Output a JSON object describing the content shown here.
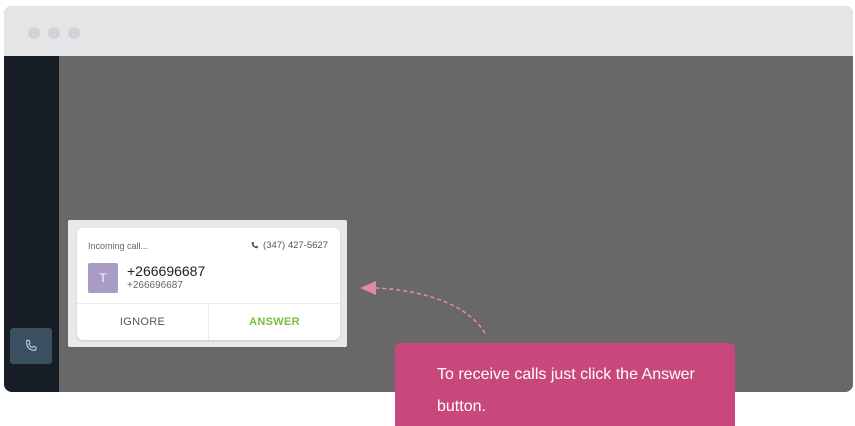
{
  "window": {
    "controls": [
      "close",
      "minimize",
      "maximize"
    ]
  },
  "sidebar": {
    "phone_button_icon": "phone-icon"
  },
  "call_card": {
    "status": "Incoming call...",
    "line_number": "(347) 427-5627",
    "avatar_letter": "T",
    "caller_name": "+266696687",
    "caller_number": "+266696687",
    "ignore_label": "IGNORE",
    "answer_label": "ANSWER"
  },
  "tooltip": {
    "text": "To receive calls just click the Answer button."
  },
  "colors": {
    "accent_pink": "#c9487b",
    "answer_green": "#7bbd3e",
    "avatar_purple": "#a89cc4",
    "sidebar_dark": "#161d24"
  }
}
